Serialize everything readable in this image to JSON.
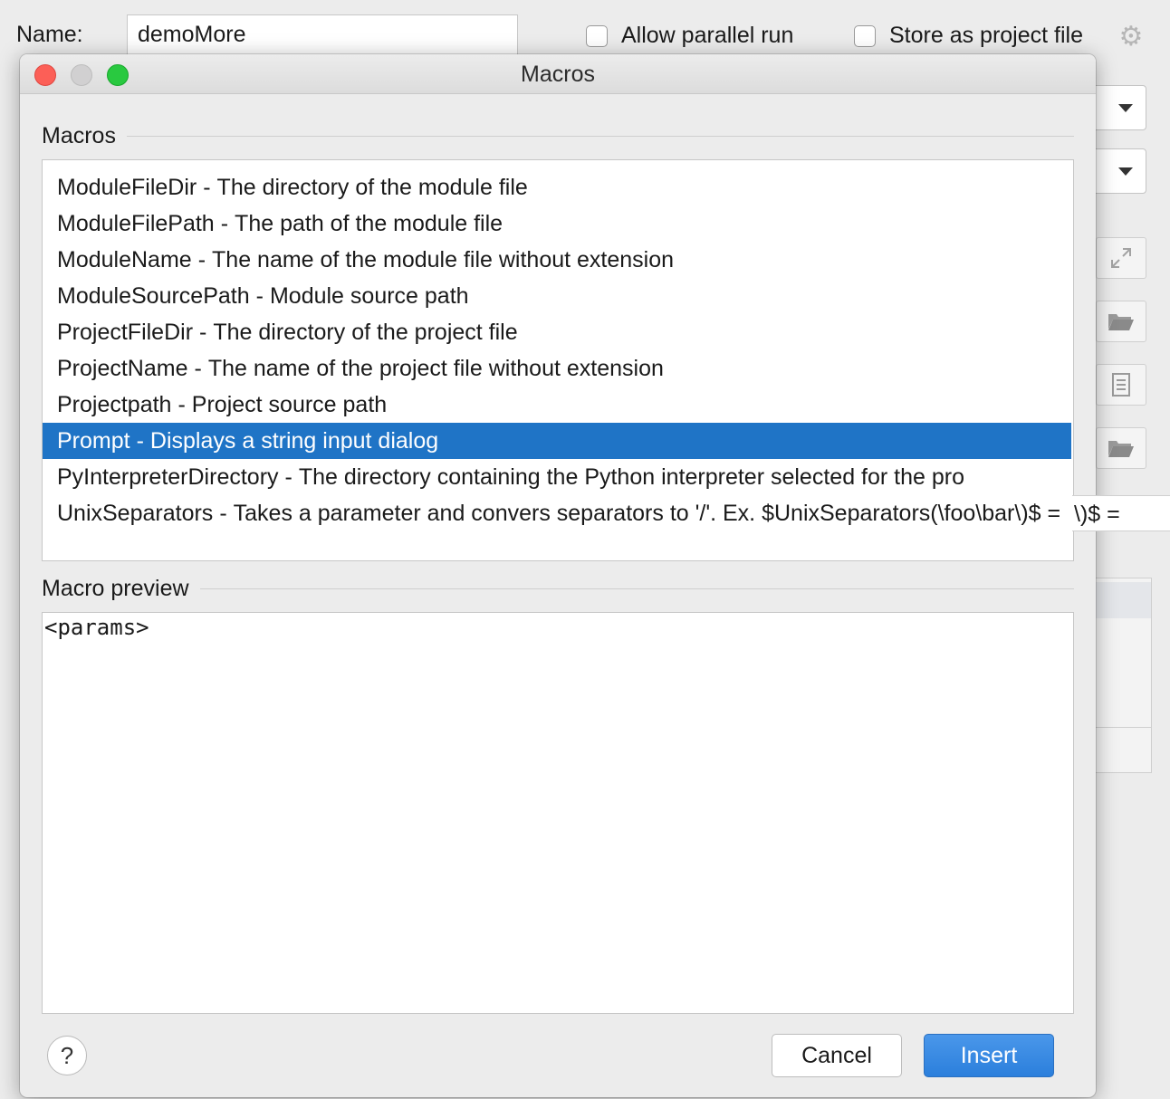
{
  "background": {
    "name_label": "Name:",
    "name_value": "demoMore",
    "allow_parallel_label": "Allow parallel run",
    "store_as_project_label": "Store as project file"
  },
  "dialog": {
    "title": "Macros",
    "macros_section_title": "Macros",
    "macros": [
      {
        "name": "ModuleFileDir",
        "description": "The directory of the module file"
      },
      {
        "name": "ModuleFilePath",
        "description": "The path of the module file"
      },
      {
        "name": "ModuleName",
        "description": "The name of the module file without extension"
      },
      {
        "name": "ModuleSourcePath",
        "description": "Module source path"
      },
      {
        "name": "ProjectFileDir",
        "description": "The directory of the project file"
      },
      {
        "name": "ProjectName",
        "description": "The name of the project file without extension"
      },
      {
        "name": "Projectpath",
        "description": "Project source path"
      },
      {
        "name": "Prompt",
        "description": "Displays a string input dialog",
        "selected": true
      },
      {
        "name": "PyInterpreterDirectory",
        "description": "The directory containing the Python interpreter selected for the pro"
      },
      {
        "name": "UnixSeparators",
        "description": "Takes a parameter and convers separators to '/'. Ex. $UnixSeparators(\\foo\\bar\\)$ ="
      }
    ],
    "separator": "-",
    "preview_section_title": "Macro preview",
    "preview_text": "<params>",
    "help_label": "?",
    "cancel_label": "Cancel",
    "insert_label": "Insert"
  },
  "colors": {
    "selection": "#1f74c6",
    "primary_button": "#2b7fdc"
  },
  "icons": [
    "gear-icon",
    "expand-icon",
    "folder-icon",
    "document-icon",
    "help-icon"
  ]
}
